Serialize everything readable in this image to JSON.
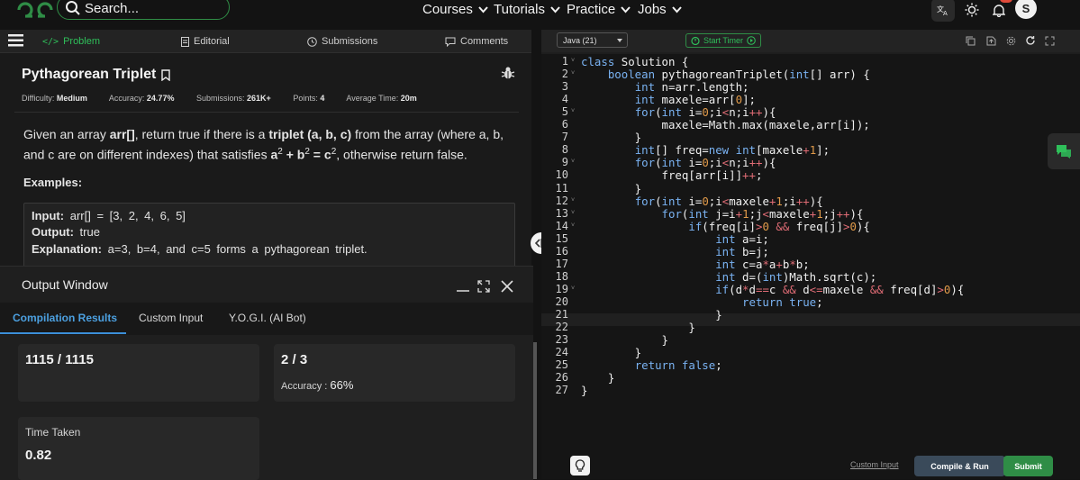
{
  "nav": {
    "search_placeholder": "Search...",
    "links": [
      "Courses",
      "Tutorials",
      "Practice",
      "Jobs"
    ],
    "notification_count": "24",
    "avatar_initial": "S"
  },
  "tabs": {
    "problem": "Problem",
    "editorial": "Editorial",
    "submissions": "Submissions",
    "comments": "Comments"
  },
  "problem": {
    "title": "Pythagorean Triplet",
    "difficulty_label": "Difficulty:",
    "difficulty": "Medium",
    "accuracy_label": "Accuracy:",
    "accuracy": "24.77%",
    "submissions_label": "Submissions:",
    "submissions": "261K+",
    "points_label": "Points:",
    "points": "4",
    "avg_time_label": "Average Time:",
    "avg_time": "20m",
    "desc_1": "Given an array ",
    "desc_arr": "arr[]",
    "desc_2": ", return true if there is a ",
    "desc_triplet": "triplet (a, b, c)",
    "desc_3": " from the array (where a, b, and c are on different indexes) that satisfies ",
    "desc_a": "a",
    "desc_b": "b",
    "desc_c": "c",
    "desc_sup": "2",
    "desc_plus": " + ",
    "desc_eq": " = ",
    "desc_4": ", otherwise return false.",
    "examples_label": "Examples:",
    "example": {
      "input_label": "Input:",
      "input": "arr[] = [3, 2, 4, 6, 5]",
      "output_label": "Output:",
      "output": "true",
      "explanation_label": "Explanation:",
      "explanation": "a=3, b=4, and c=5 forms a pythagorean triplet."
    }
  },
  "output_window": {
    "title": "Output Window",
    "tabs": [
      "Compilation Results",
      "Custom Input",
      "Y.O.G.I. (AI Bot)"
    ],
    "tests_passed": "1115 / 1115",
    "attempts": "2 / 3",
    "accuracy_label": "Accuracy :",
    "accuracy": "66%",
    "time_label": "Time Taken",
    "time": "0.82"
  },
  "editor": {
    "language": "Java (21)",
    "timer_label": "Start Timer",
    "custom_input": "Custom Input",
    "compile_run": "Compile & Run",
    "submit": "Submit",
    "code": [
      [
        [
          "kw",
          "class"
        ],
        [
          "t",
          " Solution {"
        ]
      ],
      [
        [
          "t",
          "    "
        ],
        [
          "kw",
          "boolean"
        ],
        [
          "t",
          " pythagoreanTriplet("
        ],
        [
          "kw",
          "int"
        ],
        [
          "t",
          "[] arr) {"
        ]
      ],
      [
        [
          "t",
          "        "
        ],
        [
          "kw",
          "int"
        ],
        [
          "t",
          " n=arr.length;"
        ]
      ],
      [
        [
          "t",
          "        "
        ],
        [
          "kw",
          "int"
        ],
        [
          "t",
          " maxele=arr["
        ],
        [
          "num",
          "0"
        ],
        [
          "t",
          "];"
        ]
      ],
      [
        [
          "t",
          "        "
        ],
        [
          "kw",
          "for"
        ],
        [
          "t",
          "("
        ],
        [
          "kw",
          "int"
        ],
        [
          "t",
          " i="
        ],
        [
          "num",
          "0"
        ],
        [
          "t",
          ";i"
        ],
        [
          "op",
          "<"
        ],
        [
          "t",
          "n;i"
        ],
        [
          "op",
          "++"
        ],
        [
          "t",
          "){"
        ]
      ],
      [
        [
          "t",
          "            maxele=Math.max(maxele,arr[i]);"
        ]
      ],
      [
        [
          "t",
          "        }"
        ]
      ],
      [
        [
          "t",
          "        "
        ],
        [
          "kw",
          "int"
        ],
        [
          "t",
          "[] freq="
        ],
        [
          "kw",
          "new"
        ],
        [
          "t",
          " "
        ],
        [
          "kw",
          "int"
        ],
        [
          "t",
          "[maxele"
        ],
        [
          "op",
          "+"
        ],
        [
          "num",
          "1"
        ],
        [
          "t",
          "];"
        ]
      ],
      [
        [
          "t",
          "        "
        ],
        [
          "kw",
          "for"
        ],
        [
          "t",
          "("
        ],
        [
          "kw",
          "int"
        ],
        [
          "t",
          " i="
        ],
        [
          "num",
          "0"
        ],
        [
          "t",
          ";i"
        ],
        [
          "op",
          "<"
        ],
        [
          "t",
          "n;i"
        ],
        [
          "op",
          "++"
        ],
        [
          "t",
          "){"
        ]
      ],
      [
        [
          "t",
          "            freq[arr[i]]"
        ],
        [
          "op",
          "++"
        ],
        [
          "t",
          ";"
        ]
      ],
      [
        [
          "t",
          "        }"
        ]
      ],
      [
        [
          "t",
          "        "
        ],
        [
          "kw",
          "for"
        ],
        [
          "t",
          "("
        ],
        [
          "kw",
          "int"
        ],
        [
          "t",
          " i="
        ],
        [
          "num",
          "0"
        ],
        [
          "t",
          ";i"
        ],
        [
          "op",
          "<"
        ],
        [
          "t",
          "maxele"
        ],
        [
          "op",
          "+"
        ],
        [
          "num",
          "1"
        ],
        [
          "t",
          ";i"
        ],
        [
          "op",
          "++"
        ],
        [
          "t",
          "){"
        ]
      ],
      [
        [
          "t",
          "            "
        ],
        [
          "kw",
          "for"
        ],
        [
          "t",
          "("
        ],
        [
          "kw",
          "int"
        ],
        [
          "t",
          " j=i"
        ],
        [
          "op",
          "+"
        ],
        [
          "num",
          "1"
        ],
        [
          "t",
          ";j"
        ],
        [
          "op",
          "<"
        ],
        [
          "t",
          "maxele"
        ],
        [
          "op",
          "+"
        ],
        [
          "num",
          "1"
        ],
        [
          "t",
          ";j"
        ],
        [
          "op",
          "++"
        ],
        [
          "t",
          "){"
        ]
      ],
      [
        [
          "t",
          "                "
        ],
        [
          "kw",
          "if"
        ],
        [
          "t",
          "(freq[i]"
        ],
        [
          "op",
          ">"
        ],
        [
          "num",
          "0"
        ],
        [
          "t",
          " "
        ],
        [
          "op",
          "&&"
        ],
        [
          "t",
          " freq[j]"
        ],
        [
          "op",
          ">"
        ],
        [
          "num",
          "0"
        ],
        [
          "t",
          "){"
        ]
      ],
      [
        [
          "t",
          "                    "
        ],
        [
          "kw",
          "int"
        ],
        [
          "t",
          " a=i;"
        ]
      ],
      [
        [
          "t",
          "                    "
        ],
        [
          "kw",
          "int"
        ],
        [
          "t",
          " b=j;"
        ]
      ],
      [
        [
          "t",
          "                    "
        ],
        [
          "kw",
          "int"
        ],
        [
          "t",
          " c=a"
        ],
        [
          "op",
          "*"
        ],
        [
          "t",
          "a"
        ],
        [
          "op",
          "+"
        ],
        [
          "t",
          "b"
        ],
        [
          "op",
          "*"
        ],
        [
          "t",
          "b;"
        ]
      ],
      [
        [
          "t",
          "                    "
        ],
        [
          "kw",
          "int"
        ],
        [
          "t",
          " d=("
        ],
        [
          "kw",
          "int"
        ],
        [
          "t",
          ")Math.sqrt(c);"
        ]
      ],
      [
        [
          "t",
          "                    "
        ],
        [
          "kw",
          "if"
        ],
        [
          "t",
          "(d"
        ],
        [
          "op",
          "*"
        ],
        [
          "t",
          "d"
        ],
        [
          "op",
          "=="
        ],
        [
          "t",
          "c "
        ],
        [
          "op",
          "&&"
        ],
        [
          "t",
          " d"
        ],
        [
          "op",
          "<="
        ],
        [
          "t",
          "maxele "
        ],
        [
          "op",
          "&&"
        ],
        [
          "t",
          " freq[d]"
        ],
        [
          "op",
          ">"
        ],
        [
          "num",
          "0"
        ],
        [
          "t",
          "){"
        ]
      ],
      [
        [
          "t",
          "                        "
        ],
        [
          "kw",
          "return"
        ],
        [
          "t",
          " "
        ],
        [
          "kw",
          "true"
        ],
        [
          "t",
          ";"
        ]
      ],
      [
        [
          "t",
          "                    }"
        ]
      ],
      [
        [
          "t",
          "                }"
        ]
      ],
      [
        [
          "t",
          "            }"
        ]
      ],
      [
        [
          "t",
          "        }"
        ]
      ],
      [
        [
          "t",
          "        "
        ],
        [
          "kw",
          "return"
        ],
        [
          "t",
          " "
        ],
        [
          "kw",
          "false"
        ],
        [
          "t",
          ";"
        ]
      ],
      [
        [
          "t",
          "    }"
        ]
      ],
      [
        [
          "t",
          "}"
        ]
      ]
    ]
  },
  "colors": {
    "brand_green": "#2f8d46",
    "accent_blue": "#3b8fd9",
    "keyword": "#7ab3f3",
    "operator": "#e06c75",
    "number": "#e09a4a"
  }
}
